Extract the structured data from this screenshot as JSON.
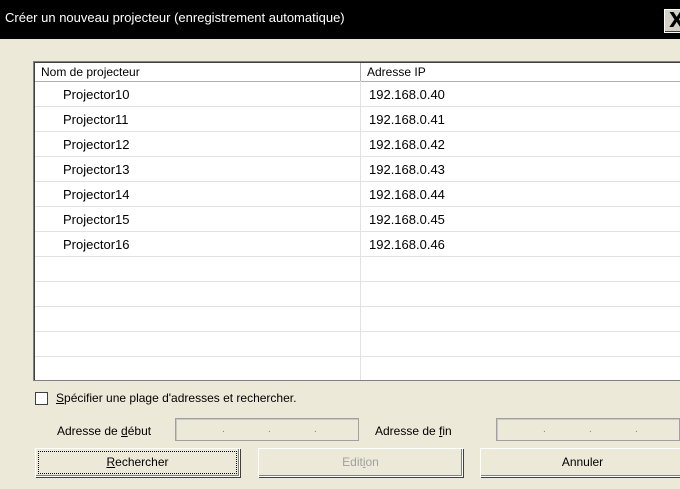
{
  "window": {
    "title": "Créer un nouveau projecteur (enregistrement automatique)",
    "close_glyph": "X"
  },
  "list": {
    "columns": [
      "Nom de projecteur",
      "Adresse IP"
    ],
    "rows": [
      {
        "name": "Projector10",
        "ip": "192.168.0.40"
      },
      {
        "name": "Projector11",
        "ip": "192.168.0.41"
      },
      {
        "name": "Projector12",
        "ip": "192.168.0.42"
      },
      {
        "name": "Projector13",
        "ip": "192.168.0.43"
      },
      {
        "name": "Projector14",
        "ip": "192.168.0.44"
      },
      {
        "name": "Projector15",
        "ip": "192.168.0.45"
      },
      {
        "name": "Projector16",
        "ip": "192.168.0.46"
      }
    ]
  },
  "range": {
    "checkbox": {
      "checked": false,
      "mnemonic": "S",
      "label_rest": "pécifier une plage d'adresses et rechercher."
    },
    "start": {
      "label_before": "Adresse de ",
      "mnemonic": "d",
      "label_after": "ébut",
      "value": ""
    },
    "end": {
      "label_before": "Adresse de ",
      "mnemonic": "f",
      "label_after": "in",
      "value": ""
    },
    "ip_separator": "."
  },
  "buttons": {
    "search": {
      "mnemonic": "R",
      "rest": "echercher"
    },
    "edit": {
      "before": "Edit",
      "mnemonic": "i",
      "after": "on",
      "enabled": false
    },
    "cancel": {
      "label": "Annuler"
    }
  }
}
